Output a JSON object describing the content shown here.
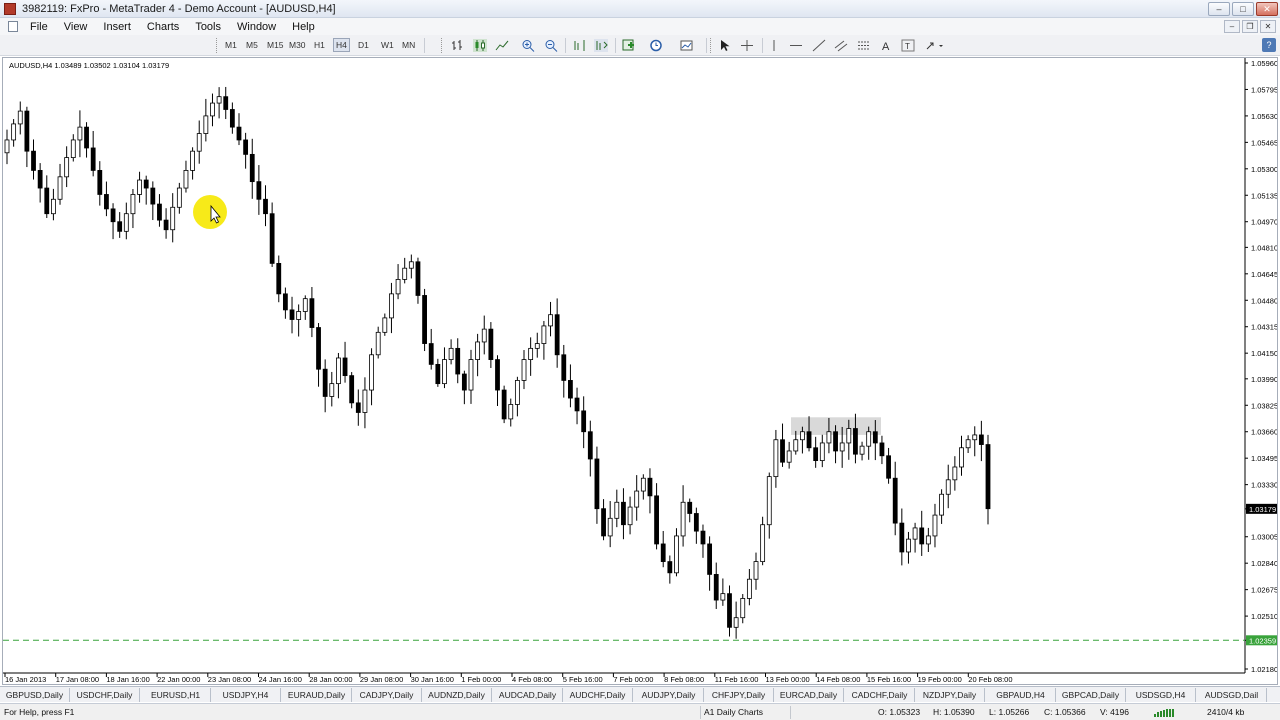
{
  "window": {
    "title": "3982119: FxPro - MetaTrader 4 - Demo Account - [AUDUSD,H4]"
  },
  "menu": [
    "File",
    "View",
    "Insert",
    "Charts",
    "Tools",
    "Window",
    "Help"
  ],
  "timeframes": [
    "M1",
    "M5",
    "M15",
    "M30",
    "H1",
    "H4",
    "D1",
    "W1",
    "MN"
  ],
  "active_timeframe": "H4",
  "chart": {
    "header": "AUDUSD,H4  1.03489 1.03502 1.03104 1.03179",
    "current_price_label": "1.03179",
    "line_price_label": "1.02359",
    "price_labels": [
      "1.05960",
      "1.05795",
      "1.05630",
      "1.05465",
      "1.05300",
      "1.05135",
      "1.04970",
      "1.04810",
      "1.04645",
      "1.04480",
      "1.04315",
      "1.04150",
      "1.03990",
      "1.03825",
      "1.03660",
      "1.03495",
      "1.03330",
      "1.03179",
      "1.03005",
      "1.02840",
      "1.02675",
      "1.02510",
      "1.02359",
      "1.02180"
    ],
    "time_labels": [
      "16 Jan 2013",
      "17 Jan 08:00",
      "18 Jan 16:00",
      "22 Jan 00:00",
      "23 Jan 08:00",
      "24 Jan 16:00",
      "28 Jan 00:00",
      "29 Jan 08:00",
      "30 Jan 16:00",
      "1 Feb 00:00",
      "4 Feb 08:00",
      "5 Feb 16:00",
      "7 Feb 00:00",
      "8 Feb 08:00",
      "11 Feb 16:00",
      "13 Feb 00:00",
      "14 Feb 08:00",
      "15 Feb 16:00",
      "19 Feb 00:00",
      "20 Feb 08:00"
    ]
  },
  "chart_data": {
    "type": "candlestick",
    "symbol": "AUDUSD",
    "timeframe": "H4",
    "ohlc_last": {
      "open": 1.03489,
      "high": 1.03502,
      "low": 1.03104,
      "close": 1.03179
    },
    "ylim": [
      1.0218,
      1.0596
    ],
    "horizontal_line": 1.02359,
    "colors": {
      "background": "#ffffff",
      "candle_up": "#ffffff",
      "candle_down": "#000000",
      "horizontal_line": "#39a33b",
      "price_highlight": "#000000"
    },
    "series": [
      {
        "name": "close",
        "values": [
          1.0548,
          1.0558,
          1.0566,
          1.0541,
          1.0529,
          1.0518,
          1.0502,
          1.0511,
          1.0525,
          1.0537,
          1.0548,
          1.0556,
          1.0543,
          1.0529,
          1.0514,
          1.0505,
          1.0497,
          1.0491,
          1.0502,
          1.0514,
          1.0523,
          1.0518,
          1.0508,
          1.0498,
          1.0492,
          1.0506,
          1.0518,
          1.0529,
          1.0541,
          1.0552,
          1.0563,
          1.0571,
          1.0575,
          1.0567,
          1.0556,
          1.0548,
          1.0539,
          1.0522,
          1.0511,
          1.0502,
          1.0471,
          1.0452,
          1.0442,
          1.0436,
          1.0441,
          1.0449,
          1.0431,
          1.0405,
          1.0388,
          1.0396,
          1.0412,
          1.0401,
          1.0384,
          1.0378,
          1.0392,
          1.0414,
          1.0428,
          1.0437,
          1.0452,
          1.0461,
          1.0468,
          1.0472,
          1.0451,
          1.0421,
          1.0408,
          1.0396,
          1.0411,
          1.0418,
          1.0402,
          1.0392,
          1.0411,
          1.0422,
          1.043,
          1.0411,
          1.0392,
          1.0374,
          1.0383,
          1.0398,
          1.0411,
          1.0418,
          1.0421,
          1.0432,
          1.0439,
          1.0414,
          1.0398,
          1.0387,
          1.0379,
          1.0366,
          1.0349,
          1.0318,
          1.0301,
          1.0312,
          1.0322,
          1.0308,
          1.0319,
          1.0329,
          1.0337,
          1.0326,
          1.0296,
          1.0285,
          1.0278,
          1.0301,
          1.0322,
          1.0315,
          1.0304,
          1.0296,
          1.0277,
          1.0261,
          1.0265,
          1.0244,
          1.025,
          1.0262,
          1.0274,
          1.0285,
          1.0308,
          1.0338,
          1.0361,
          1.0347,
          1.0354,
          1.0361,
          1.0366,
          1.0356,
          1.0348,
          1.0359,
          1.0366,
          1.0354,
          1.0359,
          1.0368,
          1.0352,
          1.0357,
          1.0366,
          1.0359,
          1.0351,
          1.0337,
          1.0309,
          1.0291,
          1.0299,
          1.0306,
          1.0296,
          1.0301,
          1.0314,
          1.0327,
          1.0336,
          1.0344,
          1.0356,
          1.0361,
          1.0364,
          1.0358,
          1.0318
        ]
      }
    ]
  },
  "tabs": [
    "GBPUSD,Daily",
    "USDCHF,Daily",
    "EURUSD,H1",
    "USDJPY,H4",
    "EURAUD,Daily",
    "CADJPY,Daily",
    "AUDNZD,Daily",
    "AUDCAD,Daily",
    "AUDCHF,Daily",
    "AUDJPY,Daily",
    "CHFJPY,Daily",
    "EURCAD,Daily",
    "CADCHF,Daily",
    "NZDJPY,Daily",
    "GBPAUD,H4",
    "GBPCAD,Daily",
    "USDSGD,H4",
    "AUDSGD,Dail"
  ],
  "status": {
    "help": "For Help, press F1",
    "profile": "A1 Daily Charts",
    "open": "O: 1.05323",
    "high": "H: 1.05390",
    "low": "L: 1.05266",
    "close": "C: 1.05366",
    "volume": "V: 4196",
    "traffic": "2410/4 kb"
  },
  "icons": {
    "toolbar": [
      "bar-chart-icon",
      "candlestick-icon",
      "line-chart-icon",
      "zoom-in-icon",
      "zoom-out-icon",
      "chart-shift-icon",
      "autoscroll-icon",
      "indicators-icon",
      "periods-icon",
      "templates-icon",
      "cursor-icon",
      "crosshair-icon",
      "vertical-line-icon",
      "horizontal-line-icon",
      "trendline-icon",
      "equidistant-channel-icon",
      "gann-grid-icon",
      "text-icon",
      "text-label-icon",
      "arrows-icon"
    ]
  }
}
